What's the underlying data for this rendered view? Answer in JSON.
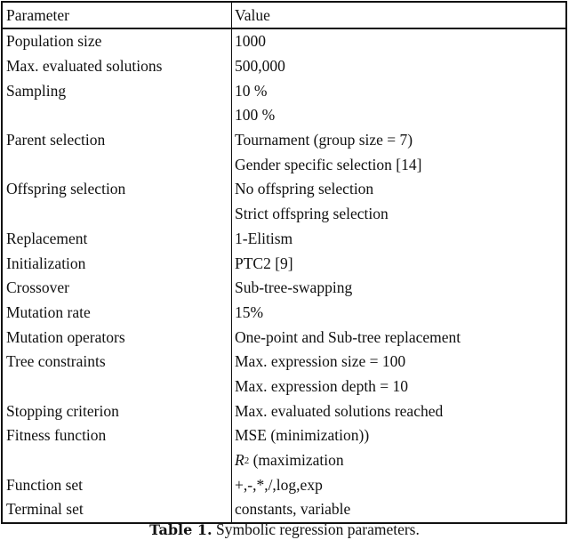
{
  "table": {
    "headers": [
      "Parameter",
      "Value"
    ],
    "rows": [
      {
        "parameter": "Population size",
        "value": "1000"
      },
      {
        "parameter": "Max. evaluated solutions",
        "value": "500,000"
      },
      {
        "parameter": "Sampling",
        "value": "10 %"
      },
      {
        "parameter": "",
        "value": "100 %"
      },
      {
        "parameter": "Parent selection",
        "value": "Tournament (group size = 7)"
      },
      {
        "parameter": "",
        "value": "Gender specific selection [14]"
      },
      {
        "parameter": "Offspring selection",
        "value": "No offspring selection"
      },
      {
        "parameter": "",
        "value": "Strict offspring selection"
      },
      {
        "parameter": "Replacement",
        "value": "1-Elitism"
      },
      {
        "parameter": "Initialization",
        "value": "PTC2 [9]"
      },
      {
        "parameter": "Crossover",
        "value": "Sub-tree-swapping"
      },
      {
        "parameter": "Mutation rate",
        "value": "15%"
      },
      {
        "parameter": "Mutation operators",
        "value": "One-point and Sub-tree replacement"
      },
      {
        "parameter": "Tree constraints",
        "value": "Max. expression size = 100"
      },
      {
        "parameter": "",
        "value": "Max. expression depth = 10"
      },
      {
        "parameter": "Stopping criterion",
        "value": "Max. evaluated solutions reached"
      },
      {
        "parameter": "Fitness function",
        "value": "MSE (minimization))"
      },
      {
        "parameter": "",
        "value_math": "R",
        "value_sup": "2",
        "value": " (maximization"
      },
      {
        "parameter": "Function set",
        "value": "+,-,*,/,log,exp"
      },
      {
        "parameter": "Terminal set",
        "value": "constants, variable"
      }
    ]
  },
  "caption": {
    "label": "Table 1.",
    "text": " Symbolic regression parameters."
  }
}
